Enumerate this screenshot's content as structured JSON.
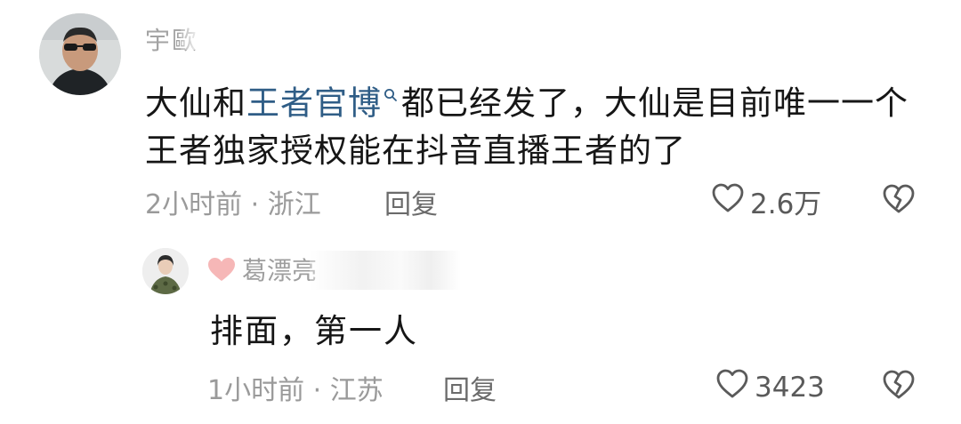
{
  "comments": [
    {
      "username": "宇歐",
      "text_before": "大仙和",
      "mention": "王者官博",
      "text_after": "都已经发了，大仙是目前唯一一个王者独家授权能在抖音直播王者的了",
      "time_location": "2小时前 · 浙江",
      "reply_label": "回复",
      "likes": "2.6万"
    }
  ],
  "replies": [
    {
      "username": "葛漂亮",
      "text": "排面，第一人",
      "time_location": "1小时前 · 江苏",
      "reply_label": "回复",
      "likes": "3423"
    }
  ],
  "icons": {
    "like": "heart-outline-icon",
    "dislike": "broken-heart-icon",
    "mention_search": "search-icon",
    "user_badge": "pink-heart-icon"
  },
  "colors": {
    "mention": "#2f5d86",
    "badge": "#f6b7b7",
    "meta": "#9a9a9a"
  }
}
